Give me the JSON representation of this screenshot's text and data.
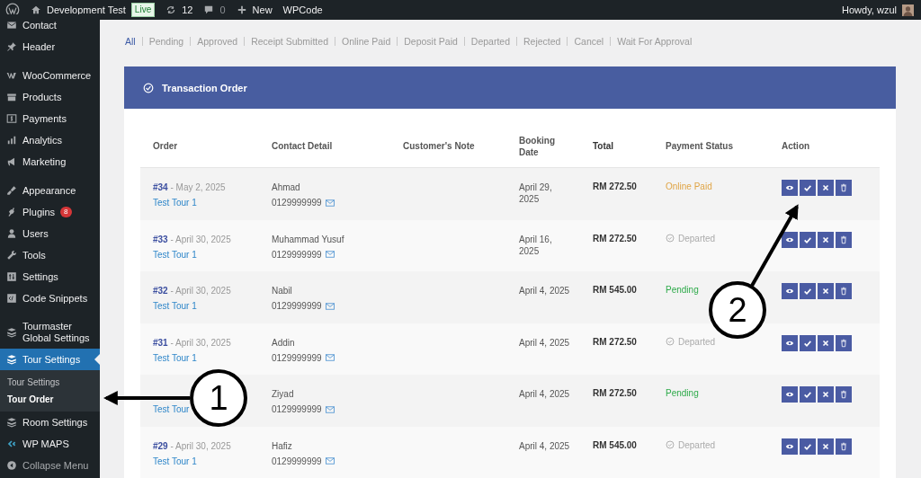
{
  "admin_bar": {
    "site_name": "Development Test",
    "site_badge": "Live",
    "updates": "12",
    "comments": "0",
    "new_label": "New",
    "plugin_link": "WPCode",
    "greeting": "Howdy, wzul"
  },
  "sidebar": {
    "sections": [
      [
        {
          "label": "Contact",
          "selected": false
        },
        {
          "label": "Header",
          "selected": false
        }
      ],
      [
        {
          "label": "WooCommerce",
          "selected": false
        },
        {
          "label": "Products",
          "selected": false
        },
        {
          "label": "Payments",
          "selected": false
        },
        {
          "label": "Analytics",
          "selected": false
        },
        {
          "label": "Marketing",
          "selected": false
        }
      ],
      [
        {
          "label": "Appearance",
          "selected": false
        },
        {
          "label": "Plugins",
          "selected": false,
          "badge": "8"
        },
        {
          "label": "Users",
          "selected": false
        },
        {
          "label": "Tools",
          "selected": false
        },
        {
          "label": "Settings",
          "selected": false
        },
        {
          "label": "Code Snippets",
          "selected": false
        }
      ],
      [
        {
          "label": "Tourmaster Global Settings",
          "selected": false
        },
        {
          "label": "Tour Settings",
          "selected": true,
          "submenu": [
            {
              "label": "Tour Settings",
              "selected": false
            },
            {
              "label": "Tour Order",
              "selected": true
            }
          ]
        },
        {
          "label": "Room Settings",
          "selected": false
        },
        {
          "label": "WP MAPS",
          "selected": false
        },
        {
          "label": "Collapse Menu",
          "selected": false
        }
      ]
    ]
  },
  "filters": [
    {
      "label": "All",
      "selected": true
    },
    {
      "label": "Pending",
      "selected": false
    },
    {
      "label": "Approved",
      "selected": false
    },
    {
      "label": "Receipt Submitted",
      "selected": false
    },
    {
      "label": "Online Paid",
      "selected": false
    },
    {
      "label": "Deposit Paid",
      "selected": false
    },
    {
      "label": "Departed",
      "selected": false
    },
    {
      "label": "Rejected",
      "selected": false
    },
    {
      "label": "Cancel",
      "selected": false
    },
    {
      "label": "Wait For Approval",
      "selected": false
    }
  ],
  "panel": {
    "title": "Transaction Order"
  },
  "table": {
    "columns": [
      "Order",
      "Contact Detail",
      "Customer's Note",
      "Booking Date",
      "Total",
      "Payment Status",
      "Action"
    ],
    "rows": [
      {
        "order_id": "#34",
        "order_date": "- May 2, 2025",
        "tour": "Test Tour 1",
        "name": "Ahmad",
        "phone": "0129999999",
        "booking_date": "April 29, 2025",
        "total": "RM 272.50",
        "status": {
          "label": "Online Paid",
          "kind": "online_paid"
        }
      },
      {
        "order_id": "#33",
        "order_date": "- April 30, 2025",
        "tour": "Test Tour 1",
        "name": "Muhammad Yusuf",
        "phone": "0129999999",
        "booking_date": "April 16, 2025",
        "total": "RM 272.50",
        "status": {
          "label": "Departed",
          "kind": "departed"
        }
      },
      {
        "order_id": "#32",
        "order_date": "- April 30, 2025",
        "tour": "Test Tour 1",
        "name": "Nabil",
        "phone": "0129999999",
        "booking_date": "April 4, 2025",
        "total": "RM 545.00",
        "status": {
          "label": "Pending",
          "kind": "pending"
        }
      },
      {
        "order_id": "#31",
        "order_date": "- April 30, 2025",
        "tour": "Test Tour 1",
        "name": "Addin",
        "phone": "0129999999",
        "booking_date": "April 4, 2025",
        "total": "RM 272.50",
        "status": {
          "label": "Departed",
          "kind": "departed"
        }
      },
      {
        "tour": "Test Tour",
        "name": "Ziyad",
        "phone": "0129999999",
        "booking_date": "April 4, 2025",
        "total": "RM 272.50",
        "status": {
          "label": "Pending",
          "kind": "pending"
        }
      },
      {
        "order_id": "#29",
        "order_date": "- April 30, 2025",
        "tour": "Test Tour 1",
        "name": "Hafiz",
        "phone": "0129999999",
        "booking_date": "April 4, 2025",
        "total": "RM 545.00",
        "status": {
          "label": "Departed",
          "kind": "departed"
        }
      }
    ]
  },
  "callouts": [
    {
      "label": "1"
    },
    {
      "label": "2"
    }
  ]
}
